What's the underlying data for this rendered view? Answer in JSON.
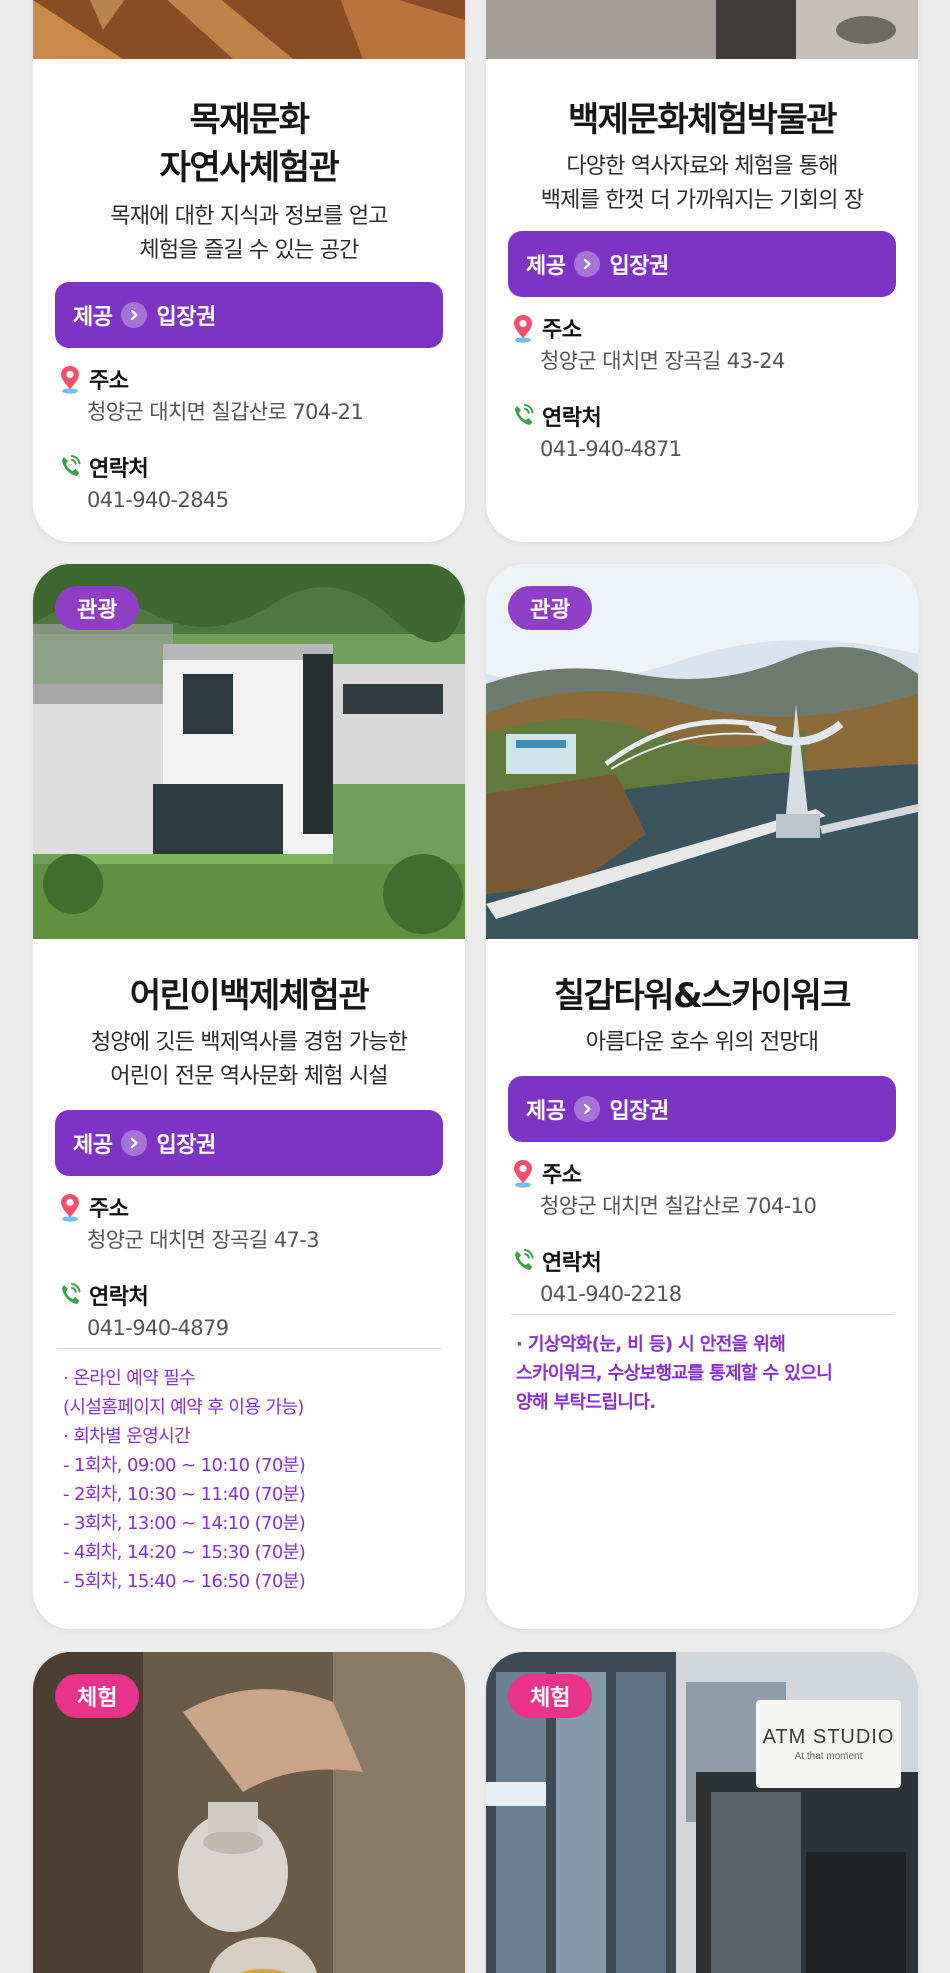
{
  "colors": {
    "offer_bar": "#7d33c4",
    "category_badge_purple": "#8e3fc6",
    "category_badge_pink": "#e9338a",
    "notice_text": "#8a2fd0"
  },
  "common": {
    "offer_prefix": "제공",
    "offer_value": "입장권",
    "address_label": "주소",
    "contact_label": "연락처"
  },
  "cards": [
    {
      "title_lines": [
        "목재문화",
        "자연사체험관"
      ],
      "desc_lines": [
        "목재에 대한 지식과 정보를 얻고",
        "체험을 즐길 수 있는 공간"
      ],
      "address": "청양군 대치면 칠갑산로 704-21",
      "contact": "041-940-2845"
    },
    {
      "title_lines": [
        "백제문화체험박물관"
      ],
      "desc_lines": [
        "다양한 역사자료와 체험을 통해",
        "백제를 한껏 더 가까워지는 기회의 장"
      ],
      "address": "청양군 대치면 장곡길 43-24",
      "contact": "041-940-4871"
    },
    {
      "category": "관광",
      "title_lines": [
        "어린이백제체험관"
      ],
      "desc_lines": [
        "청양에 깃든 백제역사를 경험 가능한",
        "어린이 전문 역사문화 체험 시설"
      ],
      "address": "청양군 대치면 장곡길 47-3",
      "contact": "041-940-4879",
      "notice_lines": [
        "· 온라인 예약 필수",
        "  (시설홈페이지 예약 후 이용 가능)",
        "· 회차별 운영시간",
        "  - 1회차, 09:00 ~ 10:10 (70분)",
        "  - 2회차, 10:30 ~ 11:40 (70분)",
        "  - 3회차, 13:00 ~ 14:10 (70분)",
        "  - 4회차, 14:20 ~ 15:30 (70분)",
        "  - 5회차, 15:40 ~ 16:50 (70분)"
      ]
    },
    {
      "category": "관광",
      "title_lines": [
        "칠갑타워&스카이워크"
      ],
      "desc_lines": [
        "아름다운 호수 위의 전망대"
      ],
      "address": "청양군 대치면 칠갑산로 704-10",
      "contact": "041-940-2218",
      "notice_lines": [
        "· 기상악화(눈, 비 등) 시 안전을 위해",
        "  스카이워크, 수상보행교를 통제할 수 있으니",
        "  양해 부탁드립니다."
      ]
    },
    {
      "category": "체험"
    },
    {
      "category": "체험",
      "sign_lines": [
        "ATM STUDIO",
        "At that moment"
      ]
    }
  ]
}
